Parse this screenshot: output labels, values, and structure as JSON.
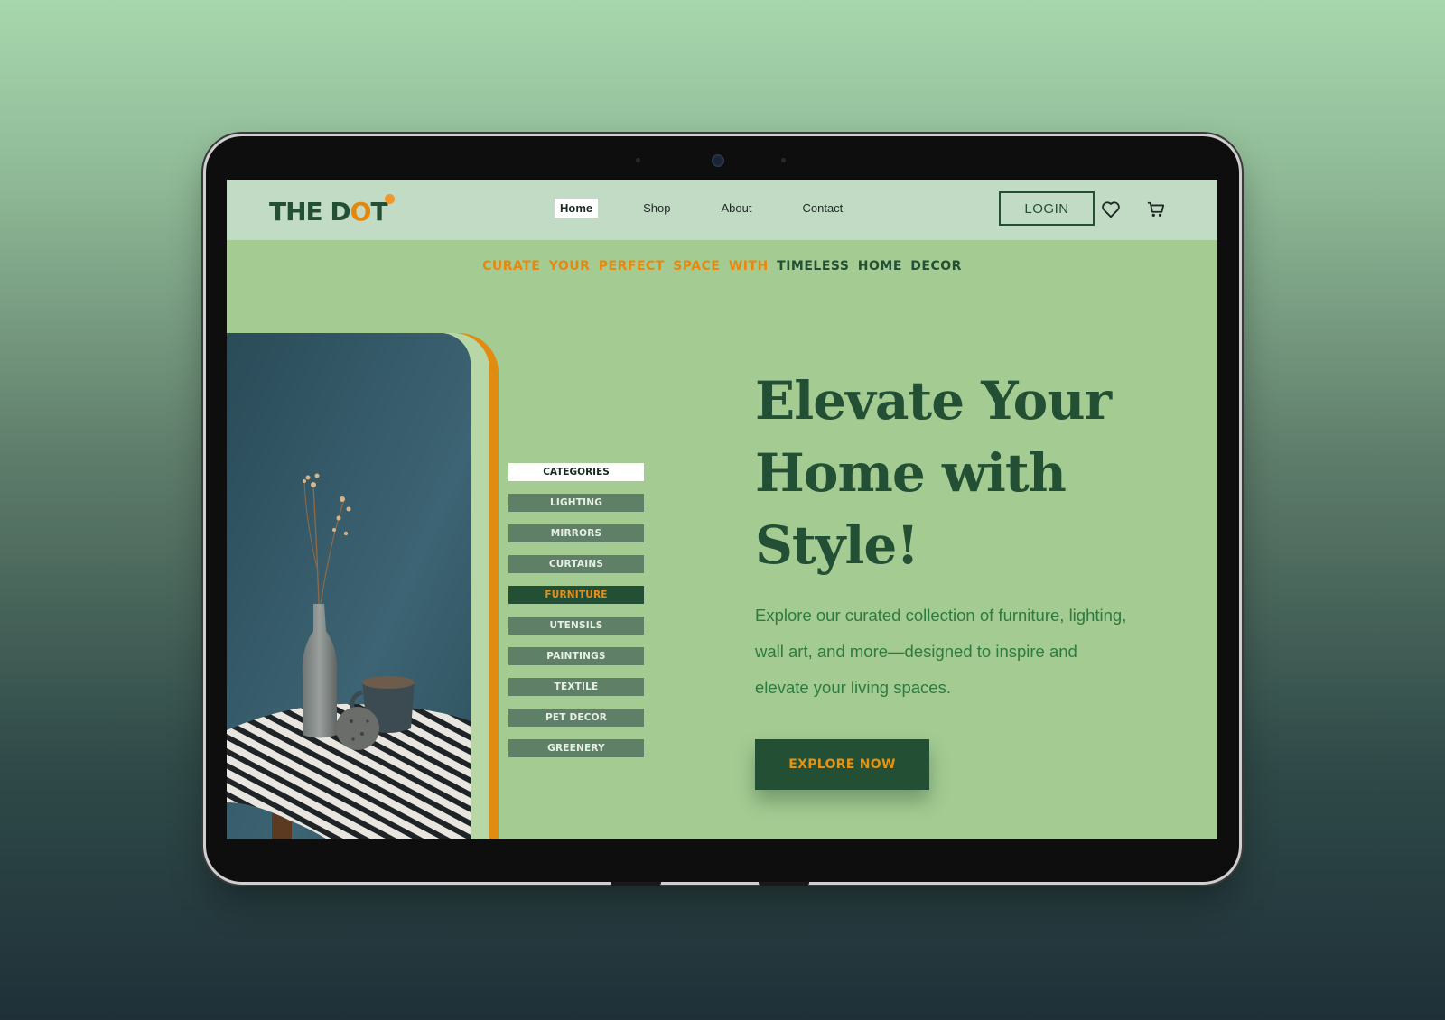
{
  "brand": {
    "name_part1": "THE D",
    "name_o": "O",
    "name_part2": "T"
  },
  "nav": {
    "links": [
      {
        "label": "Home",
        "active": true
      },
      {
        "label": "Shop",
        "active": false
      },
      {
        "label": "About",
        "active": false
      },
      {
        "label": "Contact",
        "active": false
      }
    ],
    "login_label": "LOGIN",
    "icons": [
      "heart-icon",
      "cart-icon"
    ]
  },
  "tagline": {
    "highlight": "CURATE YOUR PERFECT SPACE WITH",
    "rest": "TIMELESS HOME DECOR"
  },
  "categories": {
    "title": "CATEGORIES",
    "items": [
      "LIGHTING",
      "MIRRORS",
      "CURTAINS",
      "FURNITURE",
      "UTENSILS",
      "PAINTINGS",
      "TEXTILE",
      "PET DECOR",
      "GREENERY"
    ],
    "active": "FURNITURE"
  },
  "hero": {
    "headline": "Elevate Your Home with Style!",
    "description": "Explore our curated collection of furniture, lighting, wall art, and more—designed to inspire and elevate your living spaces.",
    "cta_label": "EXPLORE NOW"
  },
  "colors": {
    "page_bg_top": "#a7d7ad",
    "page_bg_bottom": "#1f3038",
    "nav_bg": "#c2dbc4",
    "hero_bg": "#a3cb92",
    "brand_green": "#234f34",
    "accent_orange": "#e8870f",
    "category_bg": "#5f8067"
  }
}
